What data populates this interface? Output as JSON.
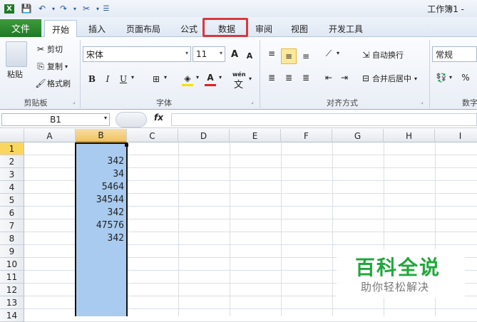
{
  "window": {
    "title": "工作簿1 -"
  },
  "tabs": [
    "文件",
    "开始",
    "插入",
    "页面布局",
    "公式",
    "数据",
    "审阅",
    "视图",
    "开发工具"
  ],
  "clipboard": {
    "paste": "粘贴",
    "cut": "剪切",
    "copy": "复制",
    "format_painter": "格式刷",
    "label": "剪贴板"
  },
  "font": {
    "name": "宋体",
    "size": "11",
    "label": "字体",
    "bold": "B",
    "italic": "I",
    "underline": "U",
    "grow": "A",
    "shrink": "A",
    "color": "A",
    "wen": "wén"
  },
  "alignment": {
    "wrap": "自动换行",
    "merge": "合并后居中",
    "label": "对齐方式"
  },
  "number": {
    "format": "常规",
    "label": "数字",
    "percent": "%"
  },
  "namebox": "B1",
  "fx": "fx",
  "columns": [
    "A",
    "B",
    "C",
    "D",
    "E",
    "F",
    "G",
    "H",
    "I"
  ],
  "rows": [
    "1",
    "2",
    "3",
    "4",
    "5",
    "6",
    "7",
    "8",
    "9",
    "10",
    "11",
    "12",
    "13",
    "14"
  ],
  "column_b_values": [
    "",
    "342",
    "34",
    "5464",
    "34544",
    "342",
    "47576",
    "342"
  ],
  "watermark": {
    "title": "百科全说",
    "subtitle": "助你轻松解决"
  },
  "colors": {
    "highlight": "#d9383d",
    "selection": "#a9cbef",
    "file_tab": "#2a8a2f",
    "watermark_green": "#21a73b"
  }
}
